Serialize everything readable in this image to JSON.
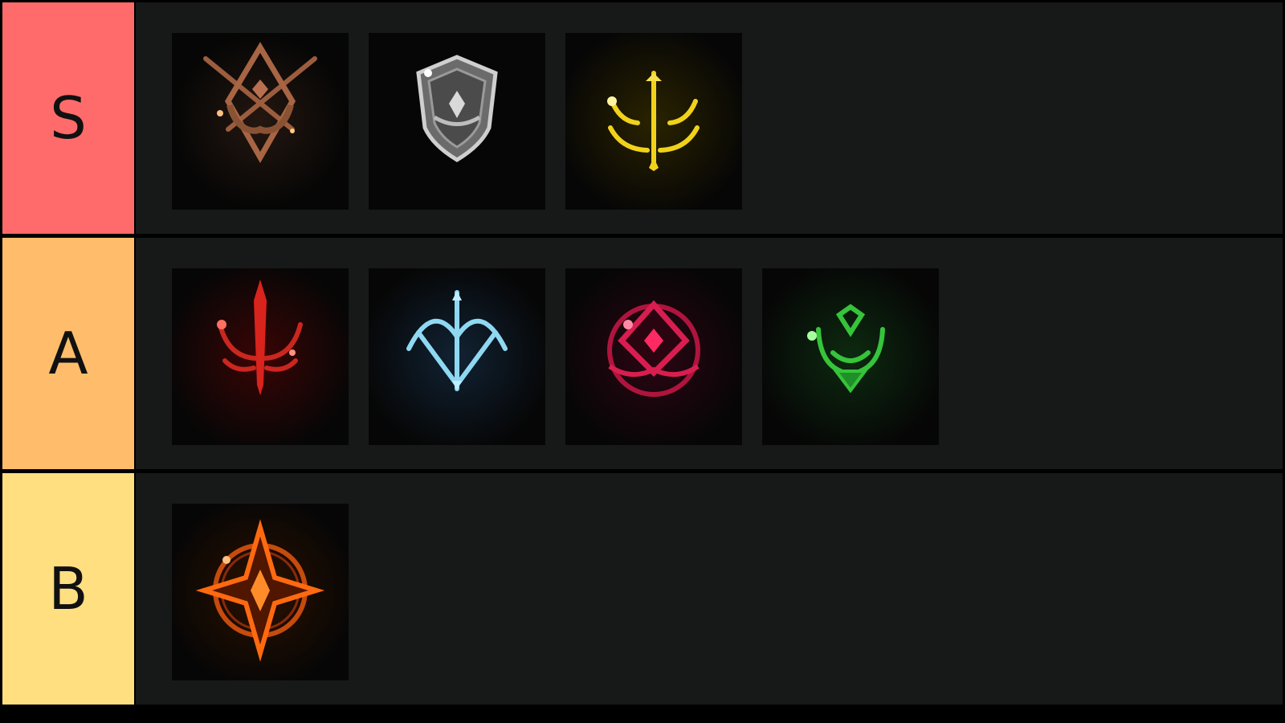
{
  "tiers": [
    {
      "label": "S",
      "color": "#ff6b6b",
      "items": [
        {
          "icon": "bronze-crossed-swords-laurel-emblem-icon",
          "accent": "#b86f4a"
        },
        {
          "icon": "silver-shield-emblem-icon",
          "accent": "#c9c9c9"
        },
        {
          "icon": "gold-trident-crest-emblem-icon",
          "accent": "#f1d21a"
        }
      ]
    },
    {
      "label": "A",
      "color": "#ffbd6b",
      "items": [
        {
          "icon": "red-trident-sword-emblem-icon",
          "accent": "#e2231a"
        },
        {
          "icon": "blue-crossed-bows-emblem-icon",
          "accent": "#8fd8f2"
        },
        {
          "icon": "crimson-diamond-lotus-emblem-icon",
          "accent": "#d81e50"
        },
        {
          "icon": "green-trident-knot-emblem-icon",
          "accent": "#36c43a"
        }
      ]
    },
    {
      "label": "B",
      "color": "#ffdf80",
      "items": [
        {
          "icon": "orange-four-point-star-circle-emblem-icon",
          "accent": "#ff6a10"
        }
      ]
    }
  ]
}
